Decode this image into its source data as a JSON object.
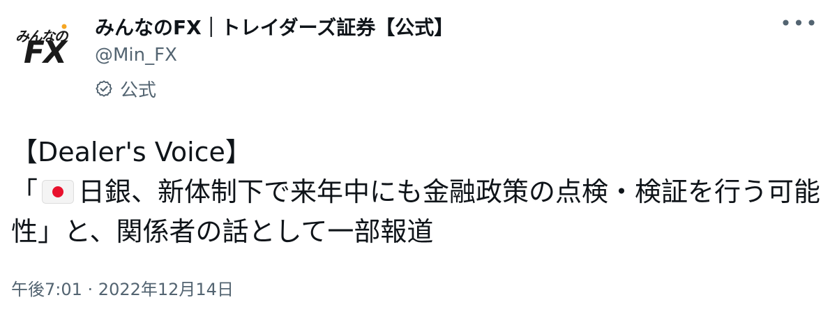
{
  "account": {
    "display_name": "みんなのFX｜トレイダーズ証券【公式】",
    "handle": "@Min_FX",
    "official_label": "公式",
    "avatar_text_top": "みんなの",
    "avatar_text_fx": "FX",
    "verified_icon": "official-badge-icon"
  },
  "tweet": {
    "line1": "【Dealer's Voice】",
    "line2_prefix": "「",
    "flag_icon": "japan-flag-icon",
    "line2_rest": "日銀、新体制下で来年中にも金融政策の点検・検証を行う可能性」と、関係者の話として一部報道"
  },
  "meta": {
    "time": "午後7:01",
    "separator": " · ",
    "date": "2022年12月14日"
  },
  "more_icon": "more-options-icon",
  "colors": {
    "text": "#0f1419",
    "secondary": "#536471",
    "flag_red": "#e8112d"
  }
}
